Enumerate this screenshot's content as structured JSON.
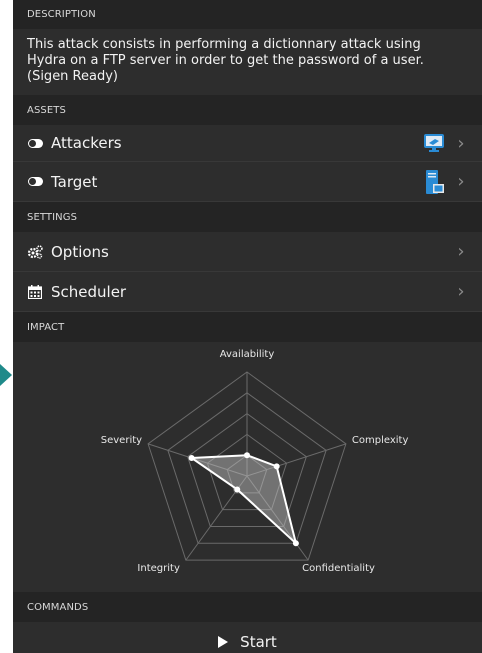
{
  "sections": {
    "description": {
      "header": "DESCRIPTION",
      "text": "This attack consists in performing a dictionnary attack using\nHydra on a FTP server in order to get the password of a user.\n(Sigen Ready)"
    },
    "assets": {
      "header": "ASSETS",
      "items": [
        {
          "label": "Attackers",
          "left_icon": "toggle-icon",
          "right_icon": "monitor-icon"
        },
        {
          "label": "Target",
          "left_icon": "toggle-icon",
          "right_icon": "server-icon"
        }
      ]
    },
    "settings": {
      "header": "SETTINGS",
      "items": [
        {
          "label": "Options",
          "left_icon": "cogs-icon"
        },
        {
          "label": "Scheduler",
          "left_icon": "calendar-icon"
        }
      ]
    },
    "impact": {
      "header": "IMPACT"
    },
    "commands": {
      "header": "COMMANDS",
      "start_label": "Start"
    }
  },
  "colors": {
    "panel_bg": "#2d2d2d",
    "header_bg": "#242424",
    "accent_teal": "#1f8a8a",
    "monitor_blue": "#2a8bd4"
  },
  "chart_data": {
    "type": "radar",
    "axes": [
      "Availability",
      "Complexity",
      "Confidentiality",
      "Integrity",
      "Severity"
    ],
    "max": 5,
    "levels": 5,
    "values": [
      1,
      1.5,
      4,
      0.8,
      2.8
    ],
    "title": "",
    "grid": true
  }
}
